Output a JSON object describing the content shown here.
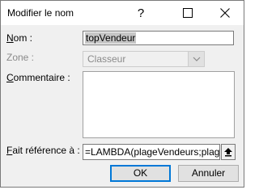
{
  "window": {
    "title": "Modifier le nom",
    "help_glyph": "?",
    "maximize_icon": "maximize-icon",
    "close_icon": "close-icon"
  },
  "form": {
    "name_label_underlined": "N",
    "name_label_rest": "om :",
    "name_value": "topVendeur",
    "zone_label": "Zone :",
    "zone_value": "Classeur",
    "comment_label_underlined": "C",
    "comment_label_rest": "ommentaire :",
    "comment_value": "",
    "ref_label_underlined": "F",
    "ref_label_rest": "ait référence à :",
    "ref_value": "=LAMBDA(plageVendeurs;plage"
  },
  "buttons": {
    "ok_label": "OK",
    "cancel_label": "Annuler"
  },
  "colors": {
    "dialog_background": "#f0f0f0",
    "default_button_border": "#0078d7",
    "disabled_text": "#8a8a8a",
    "selection_highlight": "#c6c6c6"
  }
}
